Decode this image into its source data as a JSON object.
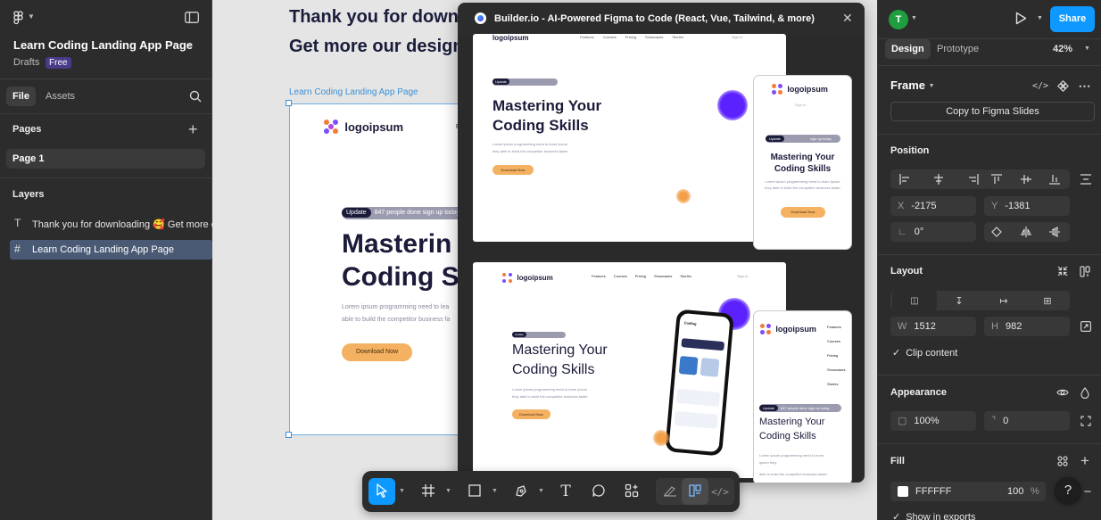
{
  "left_panel": {
    "file_title": "Learn Coding Landing App Page",
    "drafts_label": "Drafts",
    "plan_badge": "Free",
    "tabs": [
      "File",
      "Assets"
    ],
    "pages_title": "Pages",
    "pages": [
      "Page 1"
    ],
    "layers_title": "Layers",
    "layers": [
      {
        "icon": "text",
        "label": "Thank you for downloading 🥰 Get more o"
      },
      {
        "icon": "frame",
        "label": "Learn Coding Landing App Page"
      }
    ]
  },
  "canvas": {
    "heading_line1": "Thank you for downl",
    "heading_line2": "Get more our design",
    "frame_label": "Learn Coding Landing App Page",
    "frame": {
      "logo": "logoipsum",
      "nav_partial": "F",
      "pill_tag": "Update",
      "pill_text": "847 people done sign up today",
      "hero_line1": "Masterin",
      "hero_line2": "Coding S",
      "body_line1": "Lorem ipsum programming need to lea",
      "body_line2": "able to build the competitor business fa",
      "cta": "Download Now"
    }
  },
  "plugin": {
    "title": "Builder.io - AI-Powered Figma to Code (React, Vue, Tailwind, & more)",
    "close_icon": "✕",
    "nav": [
      "Features",
      "Courses",
      "Pricing",
      "Showcases",
      "Stories"
    ],
    "sign_in": "Sign In",
    "logo": "logoipsum",
    "pill_tag": "Update",
    "pill_text": "sign up today",
    "hero_line1": "Mastering Your",
    "hero_line2": "Coding Skills",
    "body_line1": "Lorem ipsum programming need to learn ipsum",
    "body_line2": "they able to build the competitor business faster",
    "cta": "Download Now",
    "phone_title": "Coding",
    "mobile_pill_tag": "Update",
    "mobile_pill_text": "847 people done sign up today",
    "mobile_hero_line1": "Mastering Your",
    "mobile_hero_line2": "Coding Skills",
    "mobile_body_line1": "Lorem ipsum programming need to learn",
    "mobile_body_line2": "ipsum they",
    "mobile_body_line3": "able to build the competitor business faster"
  },
  "toolbar": {
    "tools": [
      "move",
      "frame",
      "rectangle",
      "pen",
      "text",
      "comment",
      "actions",
      "draw",
      "design",
      "dev"
    ]
  },
  "right_panel": {
    "avatar_initial": "T",
    "share_label": "Share",
    "tabs": [
      "Design",
      "Prototype"
    ],
    "zoom": "42%",
    "frame_title": "Frame",
    "copy_button": "Copy to Figma Slides",
    "position_title": "Position",
    "x_label": "X",
    "x_value": "-2175",
    "y_label": "Y",
    "y_value": "-1381",
    "rotation_value": "0°",
    "layout_title": "Layout",
    "w_label": "W",
    "w_value": "1512",
    "h_label": "H",
    "h_value": "982",
    "clip_label": "Clip content",
    "appearance_title": "Appearance",
    "opacity_value": "100%",
    "radius_value": "0",
    "fill_title": "Fill",
    "fill_hex": "FFFFFF",
    "fill_opacity": "100",
    "fill_pct": "%",
    "show_exports": "Show in exports",
    "help": "?",
    "colors": {
      "accent": "#0d99ff",
      "avatar": "#1e9e3f",
      "selection": "#0d99ff"
    }
  }
}
